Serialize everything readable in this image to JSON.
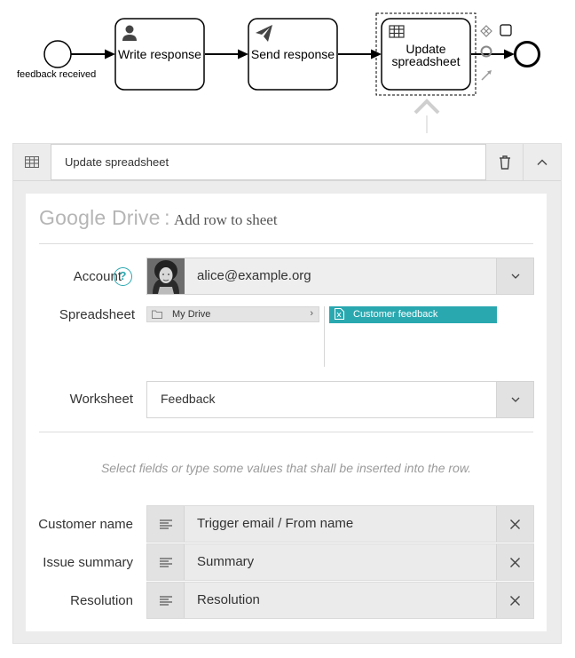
{
  "diagram": {
    "start_event_label": "feedback received",
    "tasks": [
      {
        "label": "Write response",
        "icon": "user-icon"
      },
      {
        "label": "Send response",
        "icon": "send-icon"
      },
      {
        "label_line1": "Update",
        "label_line2": "spreadsheet",
        "icon": "table-icon",
        "selected": true
      }
    ],
    "context_pad": [
      "exclusive-gateway-icon",
      "task-icon",
      "intermediate-event-icon",
      "connect-icon"
    ]
  },
  "panel": {
    "header_icon": "table-icon",
    "title": "Update spreadsheet",
    "delete_icon": "trash-icon",
    "collapse_icon": "chevron-up-icon",
    "service": "Google Drive",
    "separator": ":",
    "action": "Add row to sheet",
    "account": {
      "label": "Account",
      "help": "?",
      "value": "alice@example.org"
    },
    "spreadsheet": {
      "label": "Spreadsheet",
      "root": "My Drive",
      "selected_file": "Customer feedback"
    },
    "worksheet": {
      "label": "Worksheet",
      "value": "Feedback"
    },
    "hint": "Select fields or type some values that shall be inserted into the row.",
    "mappings": [
      {
        "label": "Customer name",
        "value": "Trigger email / From name"
      },
      {
        "label": "Issue summary",
        "value": "Summary"
      },
      {
        "label": "Resolution",
        "value": "Resolution"
      }
    ]
  },
  "colors": {
    "accent": "#2aa8b0",
    "panel_bg": "#ececec",
    "field_bg": "#eeeeee"
  }
}
